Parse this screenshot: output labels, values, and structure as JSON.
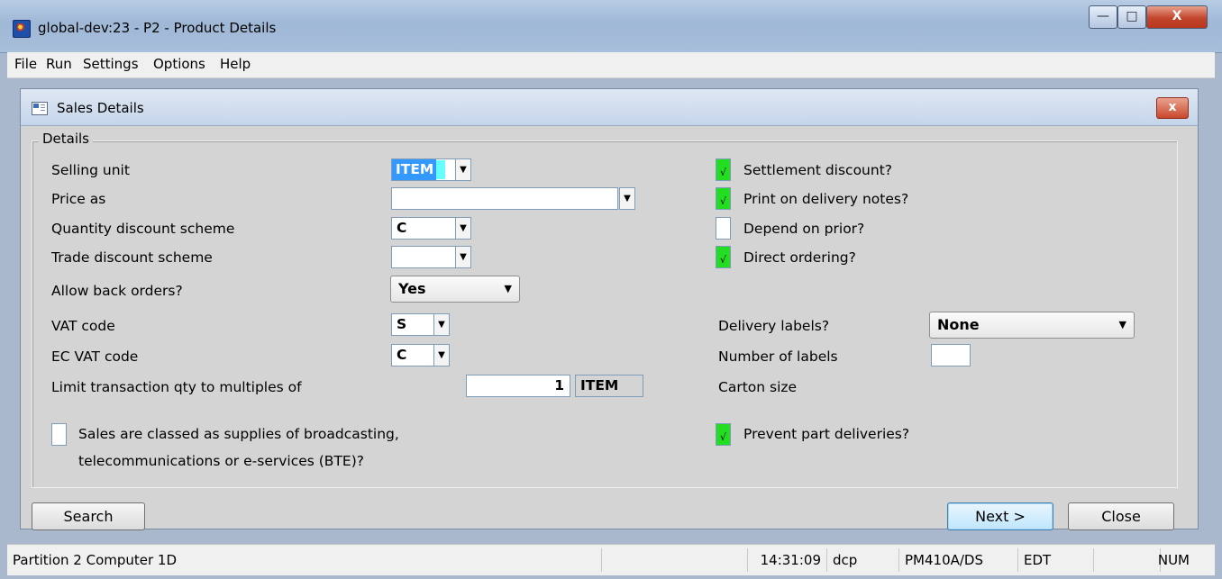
{
  "window": {
    "title": "global-dev:23 - P2 - Product Details",
    "minimize": "—",
    "maximize": "□",
    "close": "X"
  },
  "menu": [
    "File",
    "Run",
    "Settings",
    "Options",
    "Help"
  ],
  "dialog": {
    "title": "Sales Details",
    "close": "x",
    "group_title": "Details"
  },
  "fields": {
    "selling_unit": {
      "label": "Selling unit",
      "value": "ITEM"
    },
    "price_as": {
      "label": "Price as",
      "value": ""
    },
    "quantity_discount": {
      "label": "Quantity discount scheme",
      "value": "C"
    },
    "trade_discount": {
      "label": "Trade discount scheme",
      "value": ""
    },
    "allow_back_orders": {
      "label": "Allow back orders?",
      "value": "Yes"
    },
    "vat_code": {
      "label": "VAT code",
      "value": "S"
    },
    "ec_vat_code": {
      "label": "EC VAT code",
      "value": "C"
    },
    "limit_qty": {
      "label": "Limit transaction qty to multiples of",
      "value": "1",
      "unit": "ITEM"
    },
    "bte": {
      "label_line1": "Sales are classed as supplies of broadcasting,",
      "label_line2": "telecommunications or e-services (BTE)?",
      "checked": false
    }
  },
  "right": {
    "settlement_discount": {
      "label": "Settlement discount?",
      "checked": true
    },
    "print_on_delivery": {
      "label": "Print on delivery notes?",
      "checked": true
    },
    "depend_on_prior": {
      "label": "Depend on prior?",
      "checked": false
    },
    "direct_ordering": {
      "label": "Direct ordering?",
      "checked": true
    },
    "delivery_labels": {
      "label": "Delivery labels?",
      "value": "None"
    },
    "number_of_labels": {
      "label": "Number of labels",
      "value": ""
    },
    "carton_size": {
      "label": "Carton size"
    },
    "prevent_part": {
      "label": "Prevent part deliveries?",
      "checked": true
    }
  },
  "check_glyph": "√",
  "arrow_glyph": "▼",
  "buttons": {
    "search": "Search",
    "next": "Next >",
    "close": "Close"
  },
  "status": {
    "partition": "Partition 2 Computer 1D",
    "time": "14:31:09",
    "user": "dcp",
    "program": "PM410A/DS",
    "mode": "EDT",
    "num": "NUM"
  }
}
